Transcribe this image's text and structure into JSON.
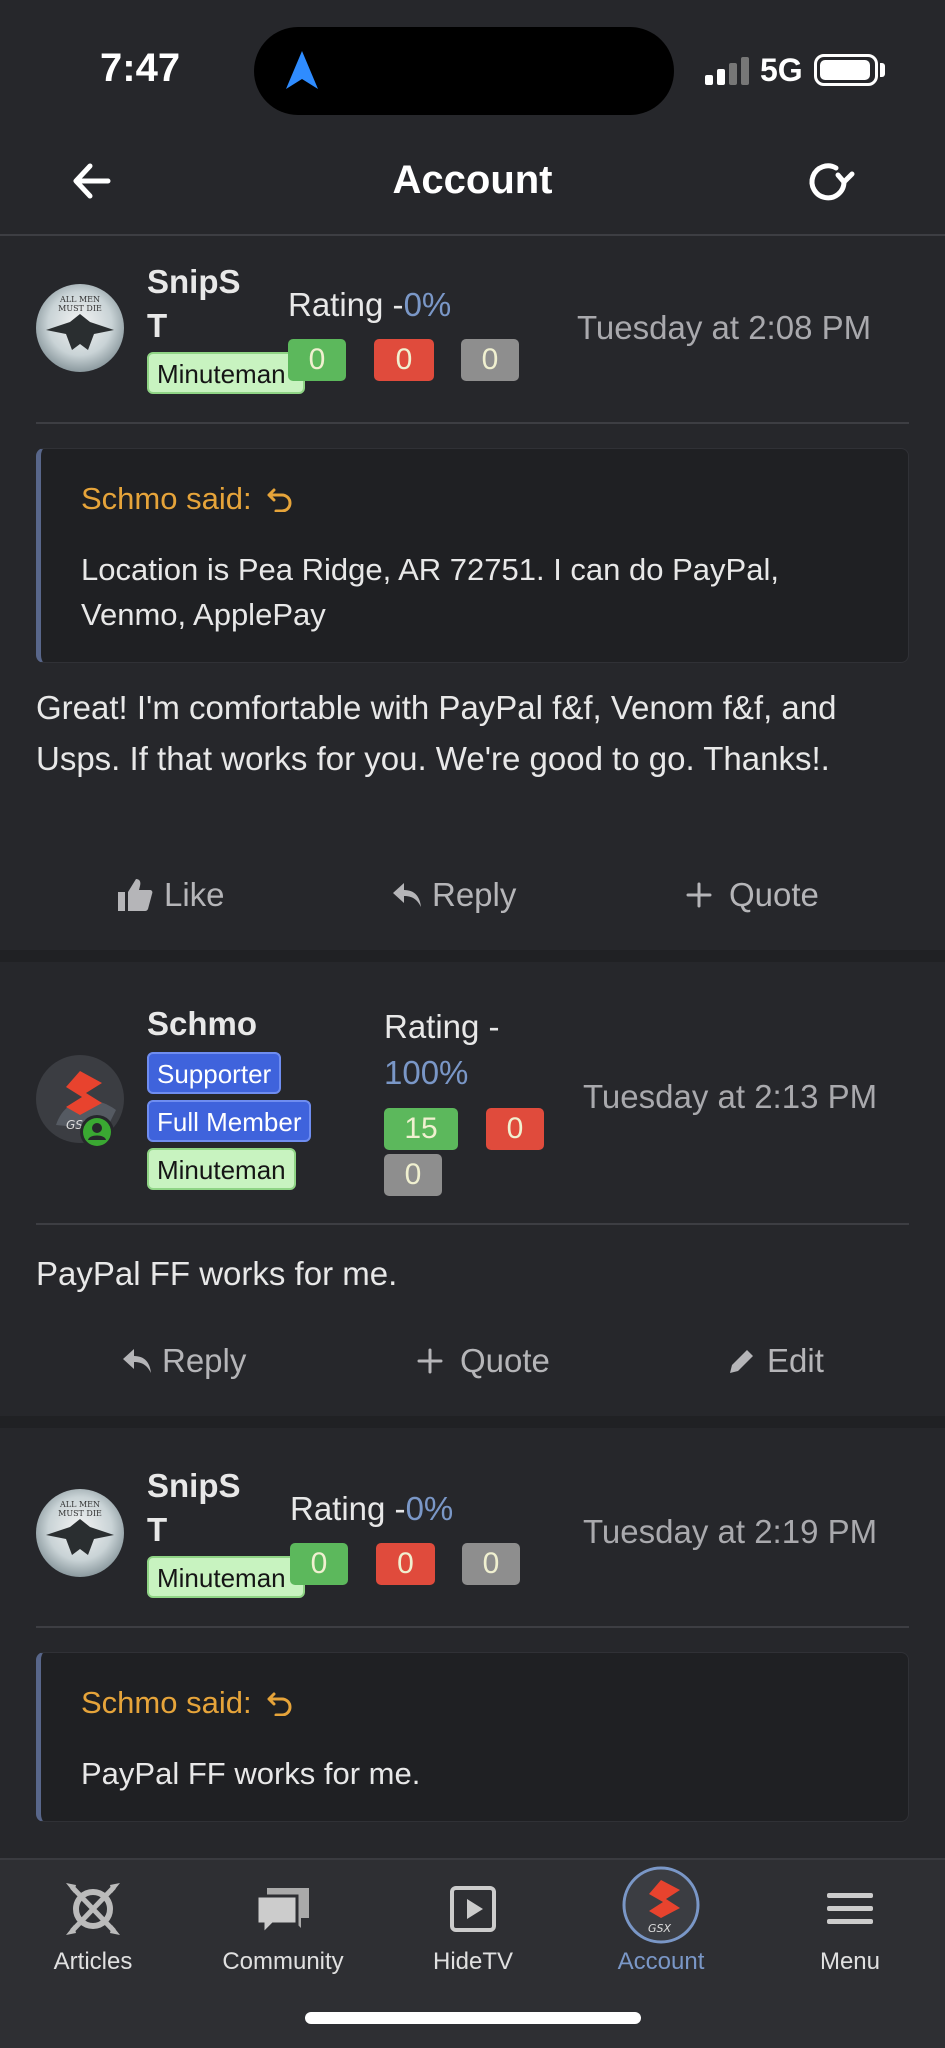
{
  "status_bar": {
    "time": "7:47",
    "network": "5G"
  },
  "header": {
    "title": "Account"
  },
  "posts": [
    {
      "user": {
        "name_line1": "SnipS",
        "name_line2": "T",
        "badges": [
          "Minuteman"
        ]
      },
      "rating": {
        "label": "Rating -",
        "percent": "0%",
        "positive": "0",
        "negative": "0",
        "neutral": "0"
      },
      "timestamp": "Tuesday at 2:08 PM",
      "quote": {
        "author": "Schmo said:",
        "text": "Location is Pea Ridge, AR 72751. I can do PayPal, Venmo, ApplePay"
      },
      "body": "Great! I'm comfortable with PayPal f&f, Venom f&f, and Usps. If that works for you. We're good to go. Thanks!.",
      "actions": [
        "Like",
        "Reply",
        "Quote"
      ]
    },
    {
      "user": {
        "name_line1": "Schmo",
        "badges": [
          "Supporter",
          "Full Member",
          "Minuteman"
        ]
      },
      "rating": {
        "label": "Rating -",
        "percent": "100%",
        "positive": "15",
        "negative": "0",
        "neutral": "0"
      },
      "timestamp": "Tuesday at 2:13 PM",
      "body": "PayPal FF works for me.",
      "actions": [
        "Reply",
        "Quote",
        "Edit"
      ]
    },
    {
      "user": {
        "name_line1": "SnipS",
        "name_line2": "T",
        "badges": [
          "Minuteman"
        ]
      },
      "rating": {
        "label": "Rating -",
        "percent": "0%",
        "positive": "0",
        "negative": "0",
        "neutral": "0"
      },
      "timestamp": "Tuesday at 2:19 PM",
      "quote": {
        "author": "Schmo said:",
        "text": "PayPal FF works for me."
      }
    }
  ],
  "tabbar": {
    "tabs": [
      {
        "label": "Articles",
        "icon": "articles-icon"
      },
      {
        "label": "Community",
        "icon": "community-icon"
      },
      {
        "label": "HideTV",
        "icon": "hidetv-icon"
      },
      {
        "label": "Account",
        "icon": "account-avatar",
        "active": true
      },
      {
        "label": "Menu",
        "icon": "menu-icon"
      }
    ]
  },
  "colors": {
    "accent": "#7a97c7",
    "quote_author": "#e6a43a",
    "background": "#26272b"
  }
}
